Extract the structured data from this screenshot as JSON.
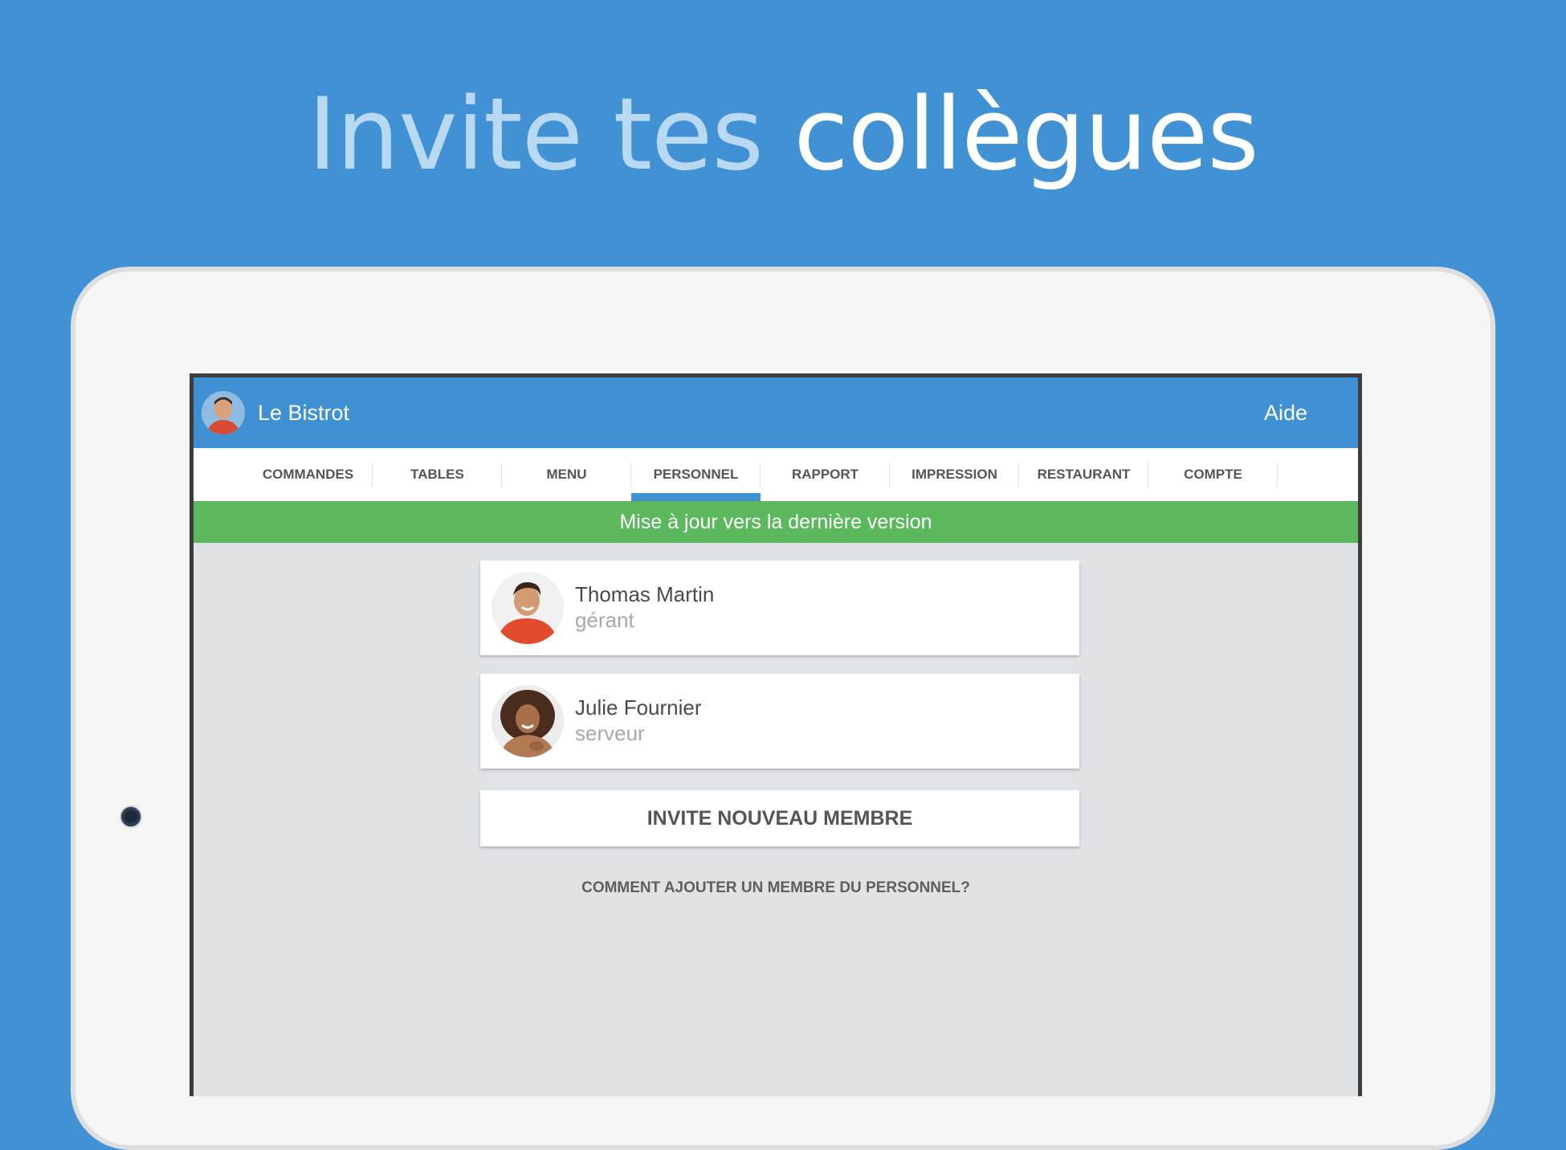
{
  "headline": {
    "light": "Invite tes",
    "bold": "collègues"
  },
  "app": {
    "restaurant_name": "Le Bistrot",
    "help_label": "Aide"
  },
  "tabs": [
    {
      "label": "COMMANDES"
    },
    {
      "label": "TABLES"
    },
    {
      "label": "MENU"
    },
    {
      "label": "PERSONNEL"
    },
    {
      "label": "RAPPORT"
    },
    {
      "label": "IMPRESSION"
    },
    {
      "label": "RESTAURANT"
    },
    {
      "label": "COMPTE"
    }
  ],
  "active_tab": "PERSONNEL",
  "banner": {
    "text": "Mise à jour vers la dernière version"
  },
  "staff": [
    {
      "name": "Thomas Martin",
      "role": "gérant"
    },
    {
      "name": "Julie Fournier",
      "role": "serveur"
    }
  ],
  "invite_button": "INVITE NOUVEAU MEMBRE",
  "howto_link": "COMMENT AJOUTER UN MEMBRE DU PERSONNEL?",
  "colors": {
    "background": "#4192d5",
    "app_bar": "#3f91d4",
    "banner": "#5cb85c",
    "content": "#dfe3e6"
  }
}
